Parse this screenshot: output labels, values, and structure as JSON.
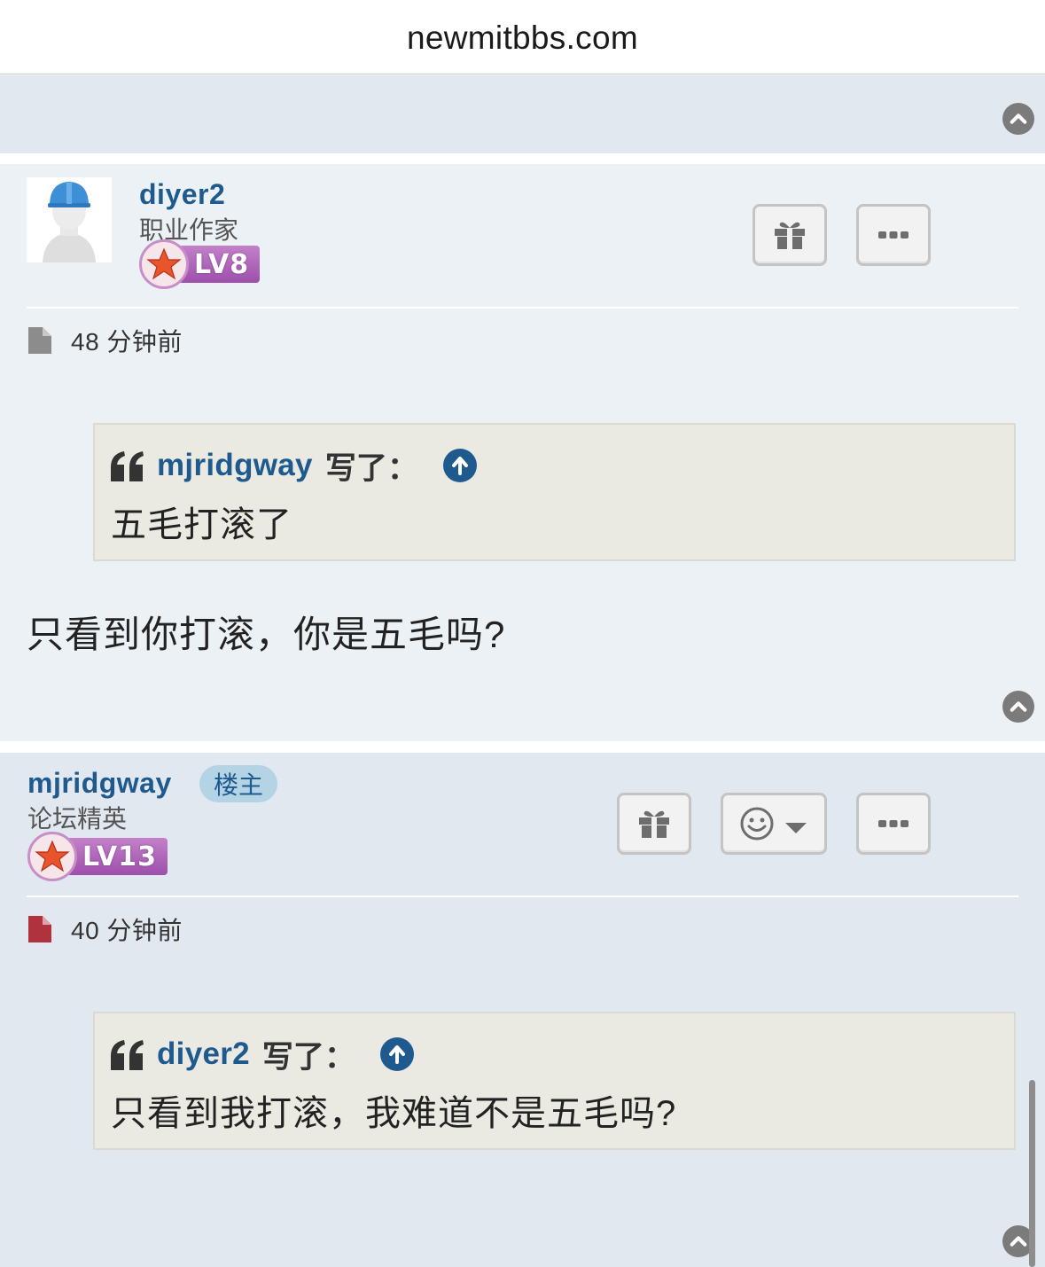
{
  "browser": {
    "url": "newmitbbs.com"
  },
  "posts": [
    {
      "username": "diyer2",
      "rank": "职业作家",
      "level": "LV8",
      "actions": {
        "gift": "gift-icon",
        "more": "more-icon"
      },
      "time": "48 分钟前",
      "file_icon_color": "#8c8c8c",
      "quote": {
        "author": "mjridgway",
        "wrote": "写了：",
        "text": "五毛打滚了"
      },
      "body": "只看到你打滚，你是五毛吗?"
    },
    {
      "username": "mjridgway",
      "op_badge": "楼主",
      "rank": "论坛精英",
      "level": "LV13",
      "actions": {
        "gift": "gift-icon",
        "reaction": "smiley-icon",
        "more": "more-icon"
      },
      "time": "40 分钟前",
      "file_icon_color": "#b0323f",
      "quote": {
        "author": "diyer2",
        "wrote": "写了：",
        "text": "只看到我打滚，我难道不是五毛吗?"
      }
    }
  ],
  "colors": {
    "username": "#1f5a8f",
    "post_bg_odd": "#ecf1f5",
    "post_bg_even": "#e2e8ef",
    "quote_bg": "#ebeae2",
    "level_badge": "#a855b5"
  }
}
